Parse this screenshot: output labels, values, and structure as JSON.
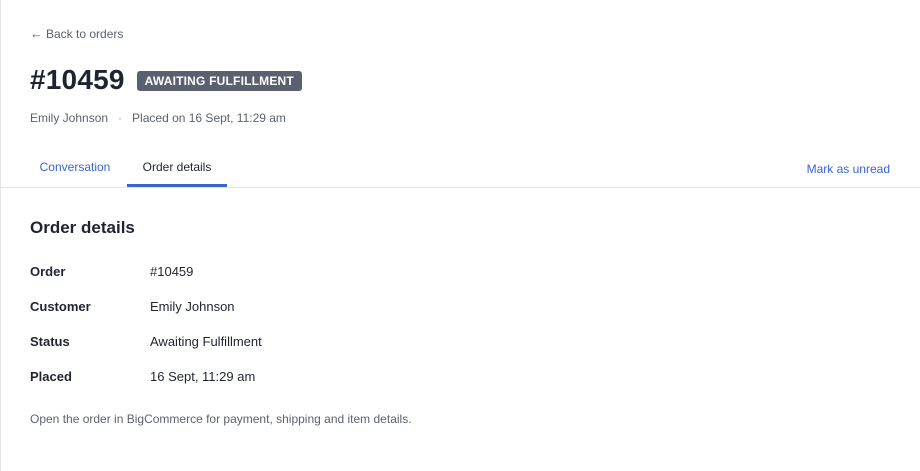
{
  "nav": {
    "back_label": "Back to orders",
    "back_arrow": "←"
  },
  "order": {
    "title": "#10459",
    "status_badge": "AWAITING FULFILLMENT",
    "customer": "Emily Johnson",
    "meta_separator": "·",
    "placed_text": "Placed on 16 Sept, 11:29 am"
  },
  "tabs": [
    {
      "label": "Conversation",
      "active": false
    },
    {
      "label": "Order details",
      "active": true
    }
  ],
  "actions": {
    "mark_unread": "Mark as unread"
  },
  "details": {
    "section_title": "Order details",
    "rows": [
      {
        "label": "Order",
        "value": "#10459"
      },
      {
        "label": "Customer",
        "value": "Emily Johnson"
      },
      {
        "label": "Status",
        "value": "Awaiting Fulfillment"
      },
      {
        "label": "Placed",
        "value": "16 Sept, 11:29 am"
      }
    ],
    "footnote": "Open the order in BigCommerce for payment, shipping and item details."
  },
  "colors": {
    "accent": "#3a63d8",
    "badge_bg": "#5b6070",
    "text": "#1f2430",
    "muted": "#5b6270"
  }
}
